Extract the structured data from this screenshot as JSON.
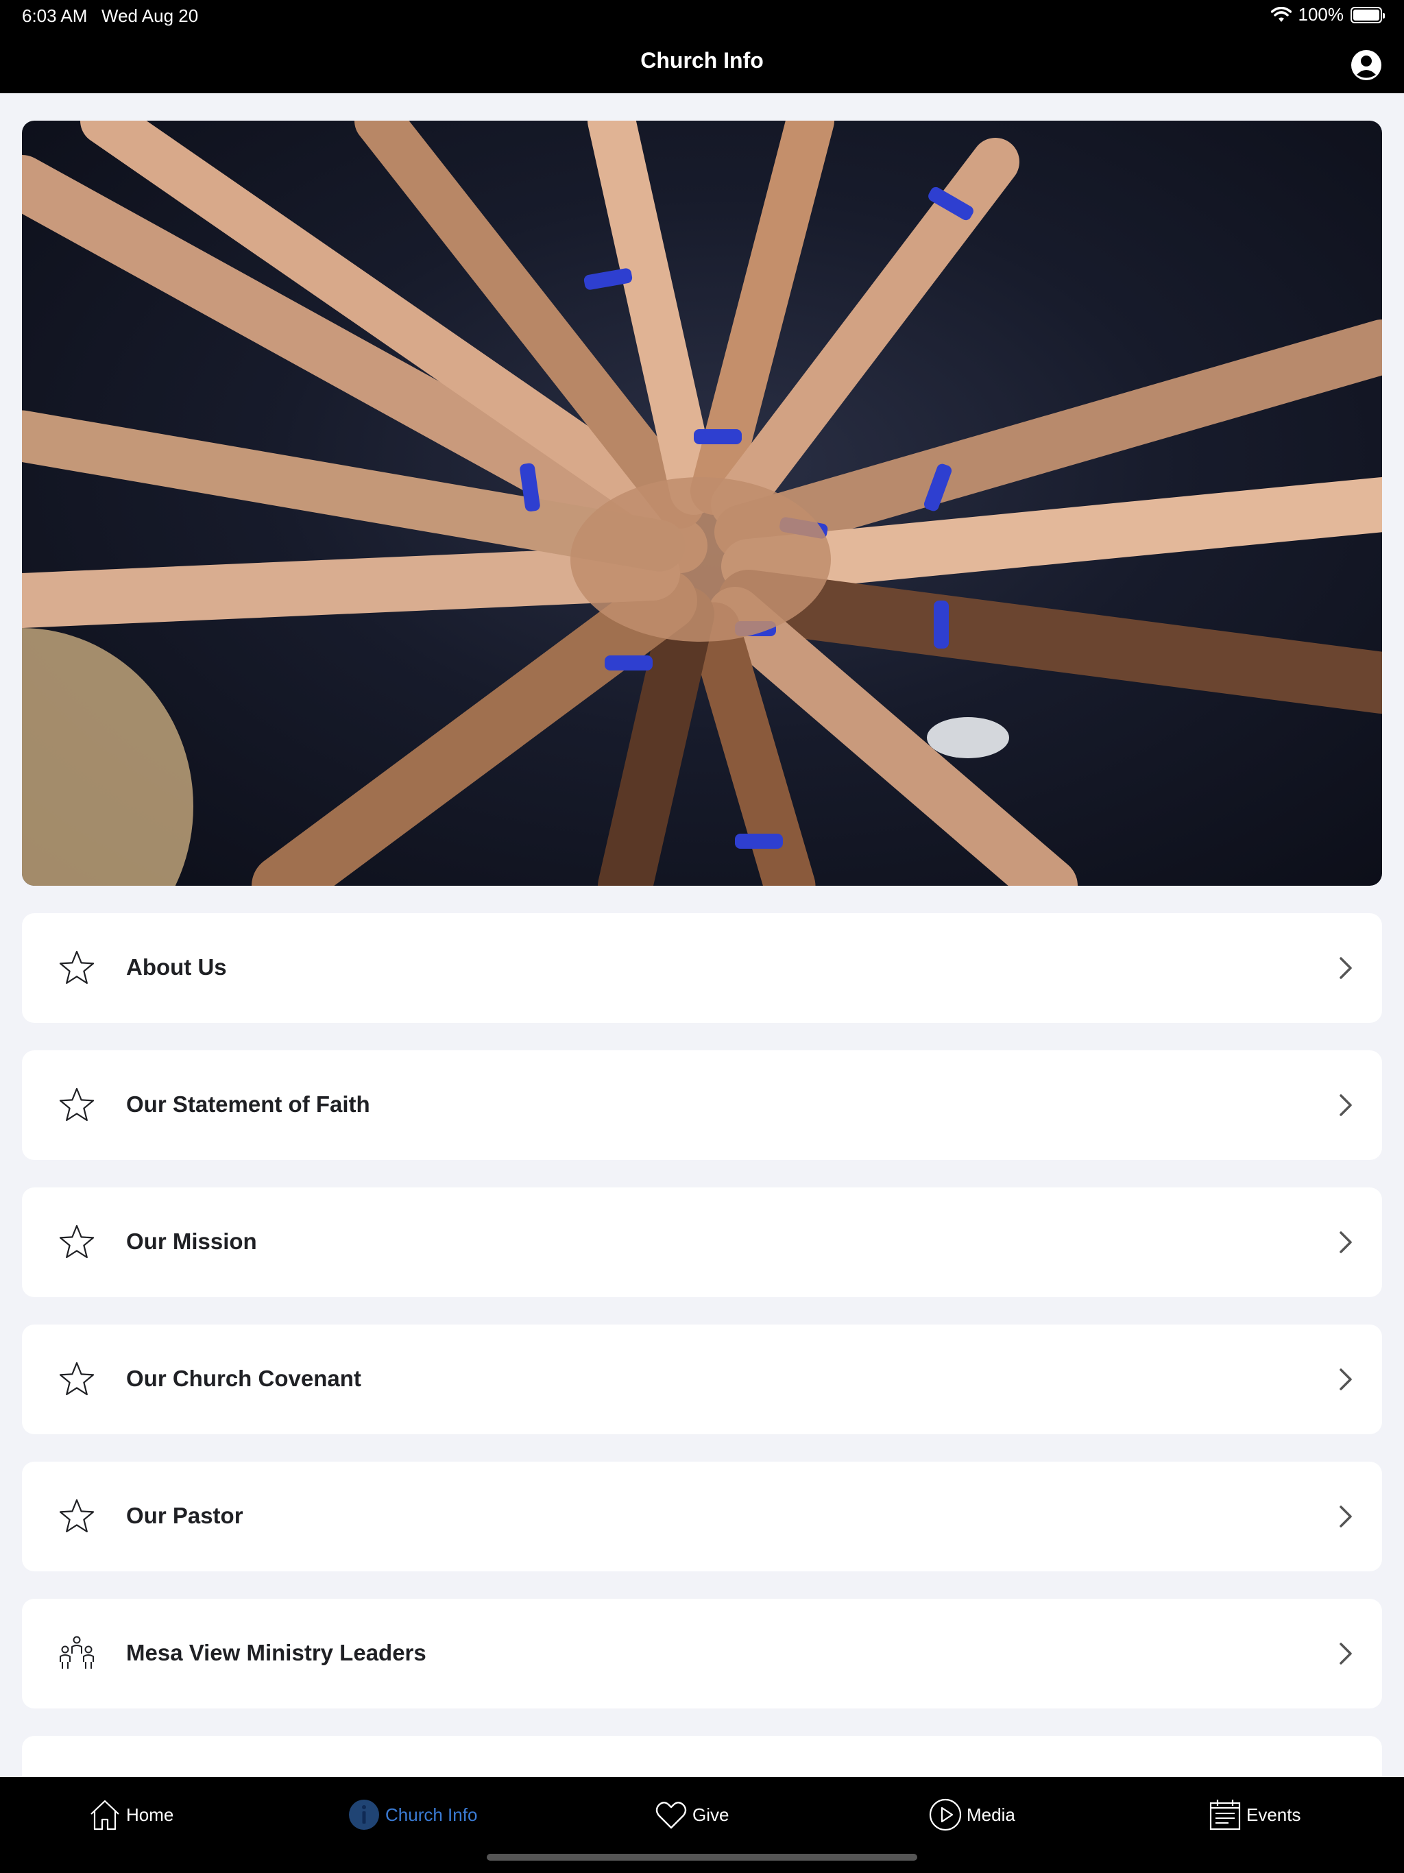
{
  "status": {
    "time": "6:03 AM",
    "date": "Wed Aug 20",
    "battery": "100%"
  },
  "nav": {
    "title": "Church Info"
  },
  "hero": {
    "icon": "photo-hands-together"
  },
  "menu": [
    {
      "label": "About Us",
      "icon": "star-icon"
    },
    {
      "label": "Our Statement of Faith",
      "icon": "star-icon"
    },
    {
      "label": "Our Mission",
      "icon": "star-icon"
    },
    {
      "label": "Our Church Covenant",
      "icon": "star-icon"
    },
    {
      "label": "Our Pastor",
      "icon": "star-icon"
    },
    {
      "label": "Mesa View Ministry Leaders",
      "icon": "people-icon"
    }
  ],
  "tabs": [
    {
      "label": "Home",
      "icon": "home-icon",
      "active": false
    },
    {
      "label": "Church Info",
      "icon": "info-icon",
      "active": true
    },
    {
      "label": "Give",
      "icon": "heart-icon",
      "active": false
    },
    {
      "label": "Media",
      "icon": "play-icon",
      "active": false
    },
    {
      "label": "Events",
      "icon": "calendar-icon",
      "active": false
    }
  ],
  "colors": {
    "active_tab": "#3b7bd4",
    "background": "#f2f3f8",
    "bar": "#000000"
  }
}
